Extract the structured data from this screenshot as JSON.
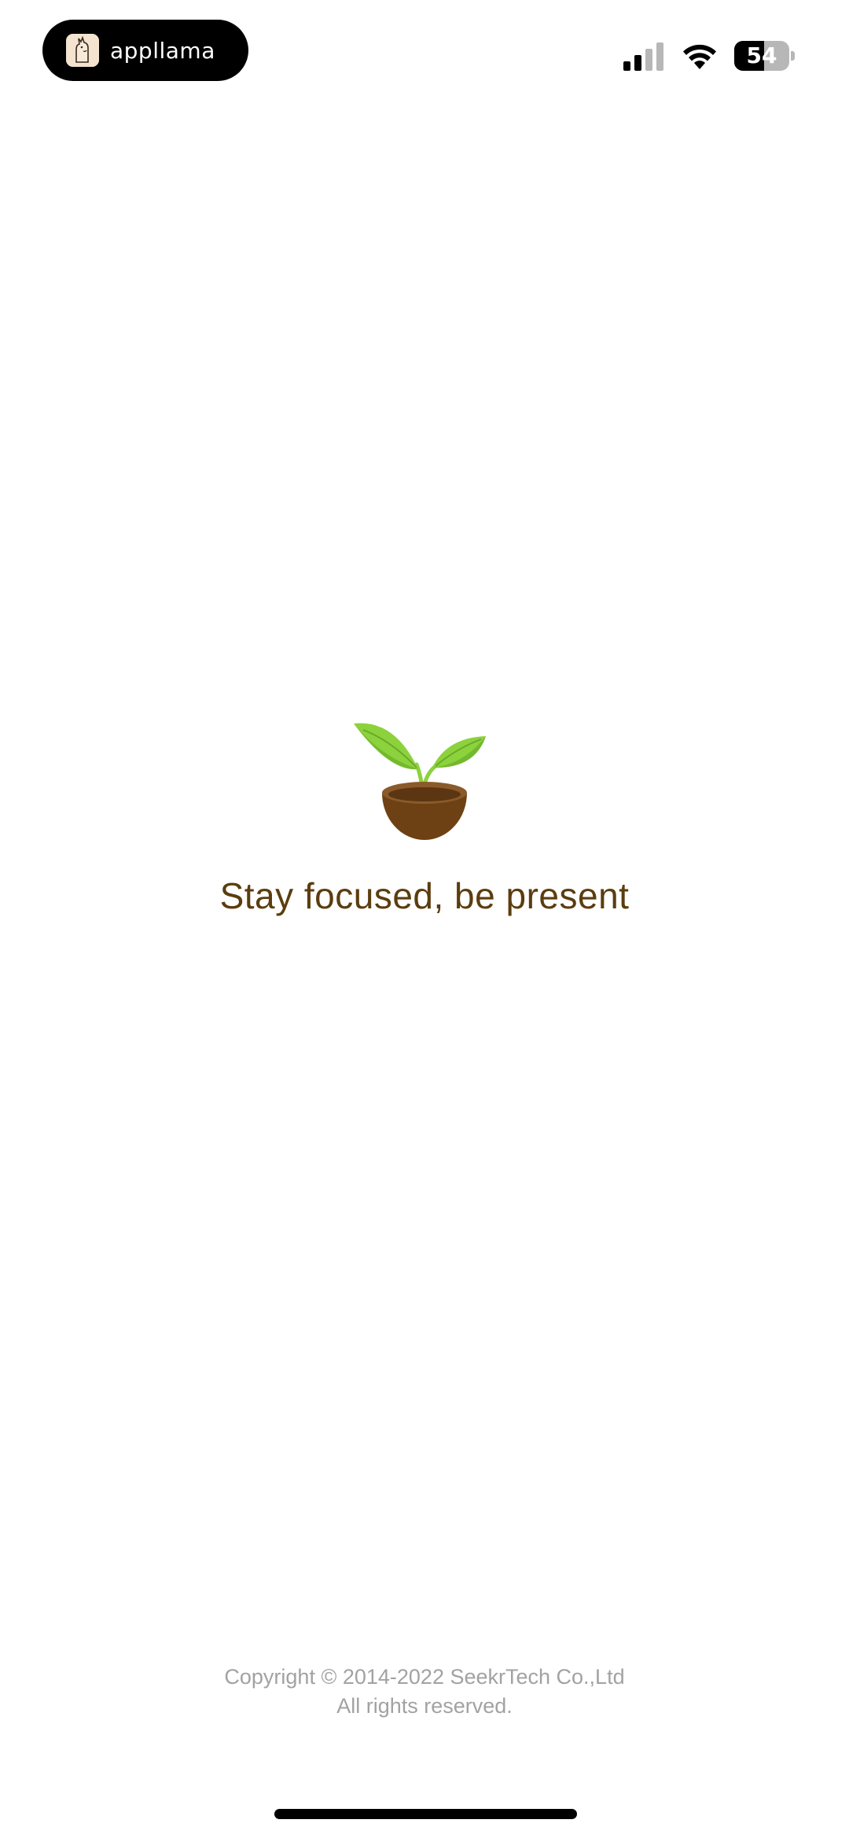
{
  "status_bar": {
    "app_pill_label": "appllama",
    "battery_percent": 54,
    "battery_text": "54",
    "signal_bars_active": 2,
    "signal_bars_total": 4,
    "icons": {
      "logo": "llama-logo-icon",
      "signal": "cellular-signal-icon",
      "wifi": "wifi-icon",
      "battery": "battery-icon"
    }
  },
  "splash": {
    "logo_icon": "sprout-in-pot-icon",
    "tagline": "Stay focused, be present"
  },
  "footer": {
    "copyright_line1": "Copyright © 2014-2022 SeekrTech Co.,Ltd",
    "copyright_line2": "All rights reserved."
  },
  "colors": {
    "tagline": "#5b3d0e",
    "copyright": "#a2a2a2",
    "leaf": "#8cd23c",
    "pot": "#6e4114"
  }
}
